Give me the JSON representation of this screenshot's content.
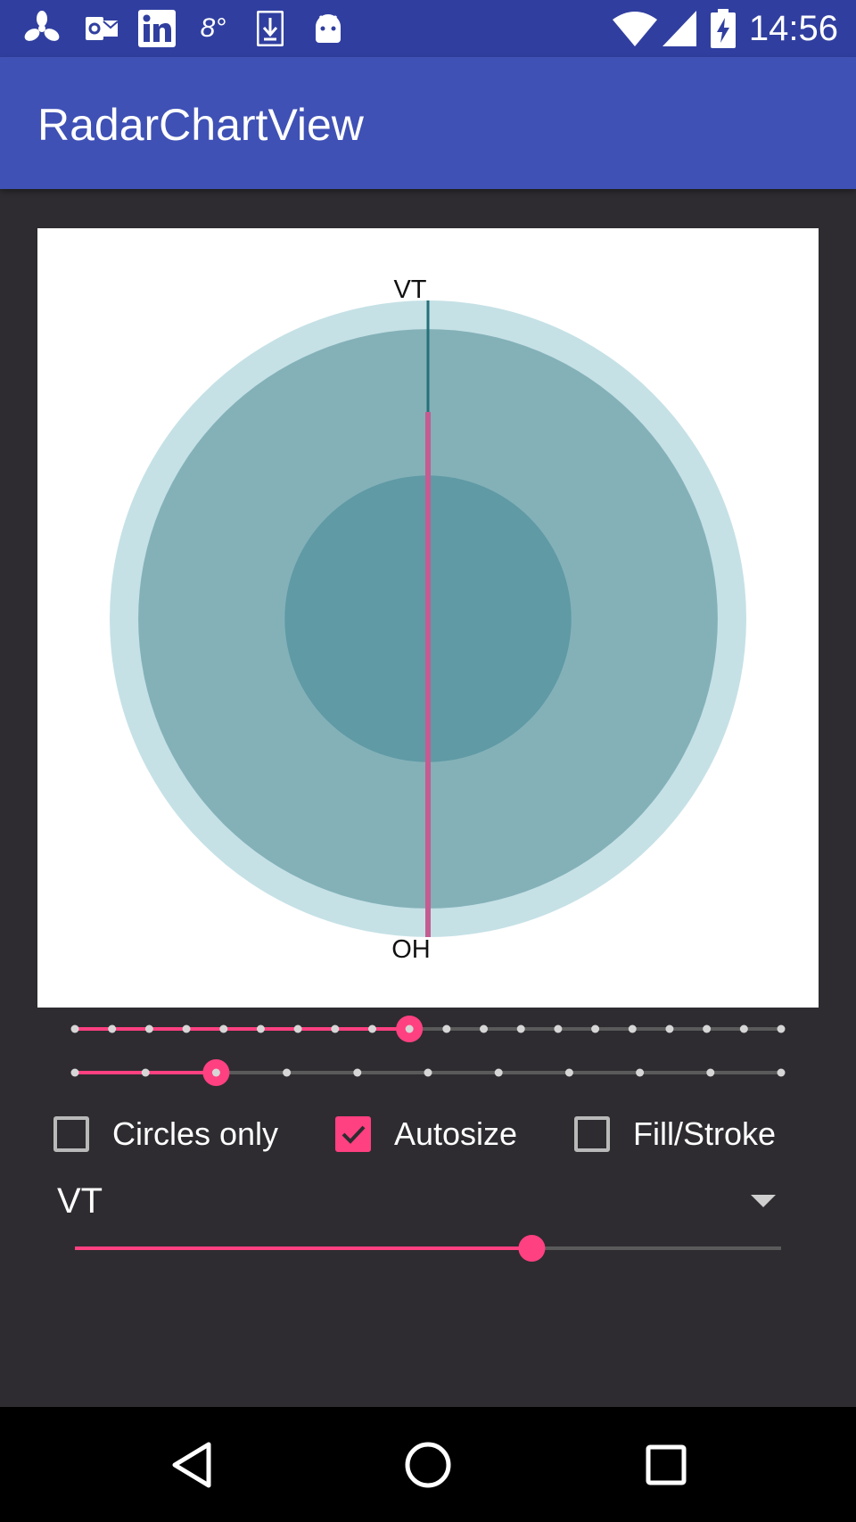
{
  "status_bar": {
    "time": "14:56",
    "left_icons": [
      "pinwheel-icon",
      "outlook-icon",
      "linkedin-icon",
      "weather-icon",
      "download-icon",
      "android-icon"
    ],
    "right_icons": [
      "wifi-icon",
      "signal-icon",
      "battery-icon"
    ]
  },
  "app_bar": {
    "title": "RadarChartView"
  },
  "chart": {
    "top_label": "VT",
    "bottom_label": "OH",
    "rings": [
      {
        "level": 1.0,
        "color": "#c5e1e6"
      },
      {
        "level": 0.91,
        "color": "#84b1b8"
      },
      {
        "level": 0.45,
        "color": "#5f9aa5"
      }
    ],
    "axis_color": "#26707a",
    "highlight_color": "#c45c92"
  },
  "sliders": {
    "first": {
      "steps": 20,
      "selected_index": 9,
      "tick_positions": [
        0,
        1,
        2,
        3,
        4,
        5,
        6,
        7,
        8,
        9,
        10,
        11,
        12,
        13,
        14,
        15,
        16,
        17,
        18,
        19
      ]
    },
    "second": {
      "steps": 11,
      "selected_index": 2,
      "tick_positions": [
        0,
        1,
        2,
        3,
        4,
        5,
        6,
        7,
        8,
        9,
        10
      ]
    },
    "value_slider": {
      "fraction": 0.647
    }
  },
  "checkboxes": [
    {
      "label": "Circles only",
      "checked": false
    },
    {
      "label": "Autosize",
      "checked": true
    },
    {
      "label": "Fill/Stroke",
      "checked": false
    }
  ],
  "spinner": {
    "value": "VT"
  },
  "colors": {
    "accent": "#ff4081",
    "track": "#5a5a5a",
    "tick": "#d6d6d6"
  },
  "nav_bar": {
    "buttons": [
      "back-icon",
      "home-icon",
      "recents-icon"
    ]
  }
}
